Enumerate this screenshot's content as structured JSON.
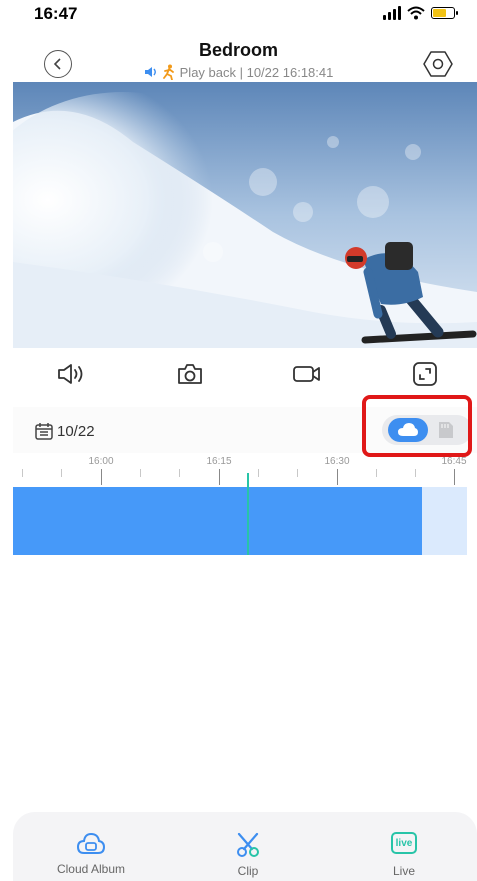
{
  "status_bar": {
    "time": "16:47"
  },
  "header": {
    "title": "Bedroom",
    "subtitle": "Play back | 10/22 16:18:41"
  },
  "date_selector": {
    "date": "10/22"
  },
  "timeline": {
    "ticks": [
      "16:00",
      "16:15",
      "16:30",
      "16:45"
    ],
    "recording_fraction": 0.9
  },
  "bottom_nav": {
    "cloud_album": "Cloud Album",
    "clip": "Clip",
    "live": "Live",
    "live_badge": "live"
  },
  "colors": {
    "accent": "#3d8ef0",
    "recording": "#4699f9",
    "cursor": "#28c4a8",
    "highlight": "#e01818"
  },
  "icons": [
    "back-icon",
    "settings-hexagon-icon",
    "speaker-icon",
    "person-motion-icon",
    "volume-icon",
    "camera-icon",
    "record-icon",
    "fullscreen-icon",
    "calendar-icon",
    "cloud-icon",
    "sd-card-icon",
    "cloud-album-icon",
    "scissors-icon",
    "live-icon"
  ]
}
